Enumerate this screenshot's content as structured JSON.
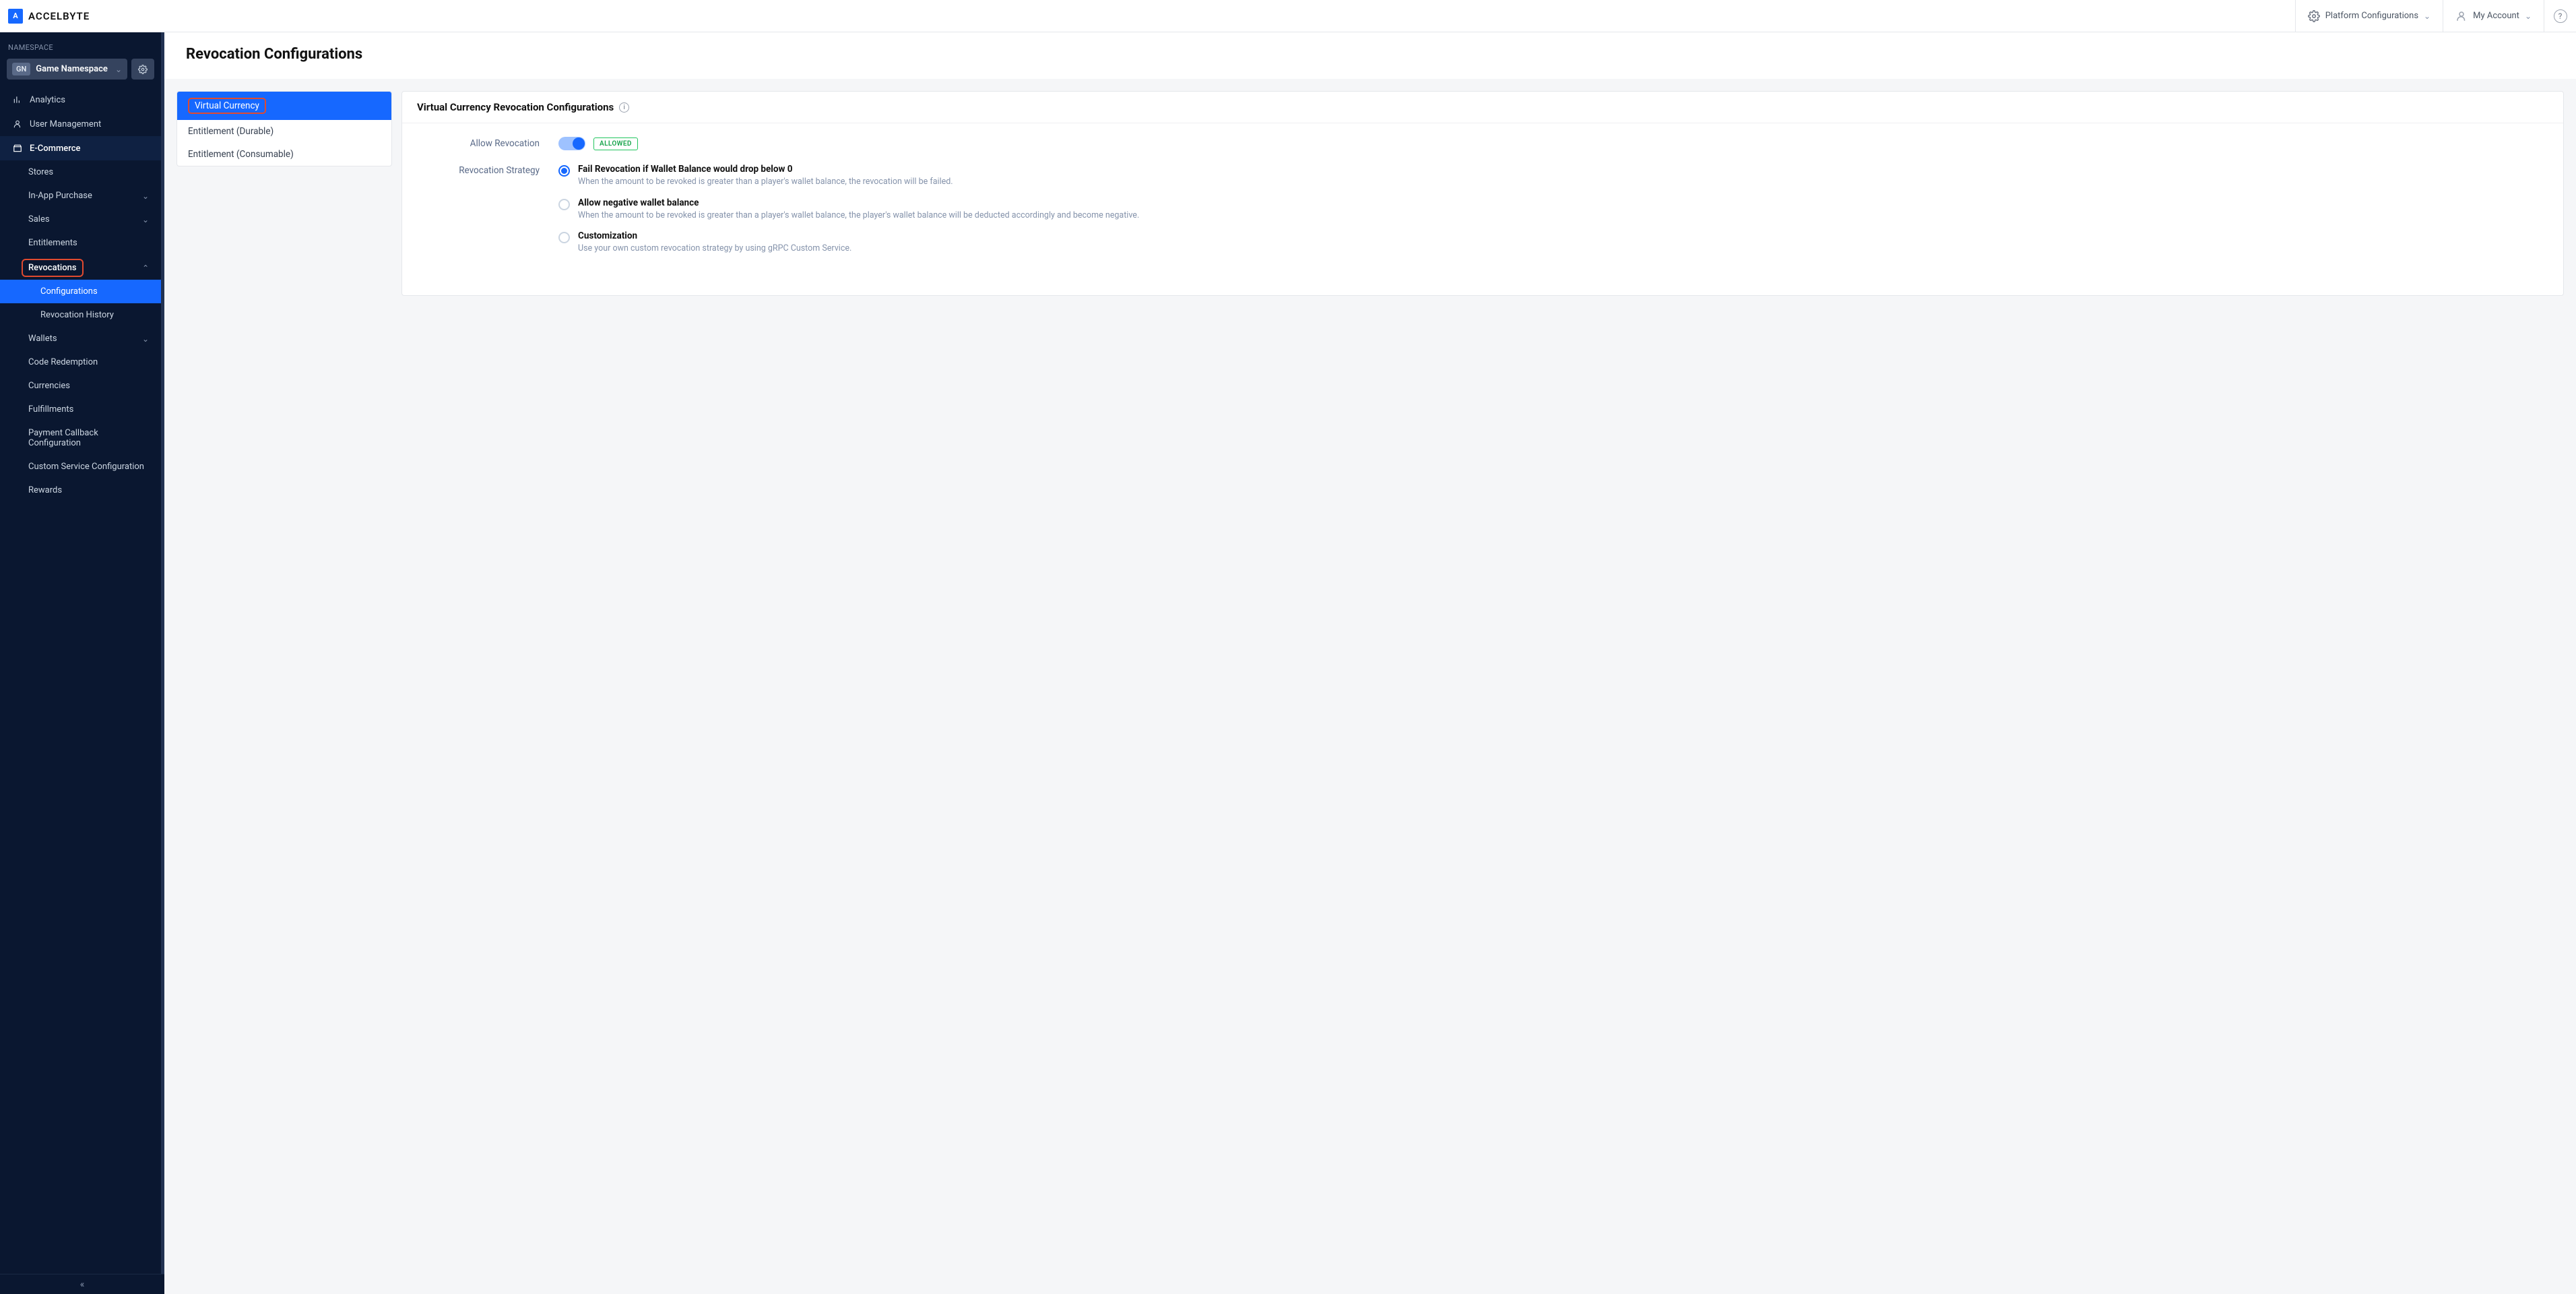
{
  "brand": {
    "logo_letters": "A",
    "name": "ACCELBYTE"
  },
  "topbar": {
    "platform_config": "Platform Configurations",
    "my_account": "My Account"
  },
  "sidebar": {
    "namespace_label": "NAMESPACE",
    "ns_badge": "GN",
    "ns_name": "Game Namespace",
    "items": {
      "analytics": "Analytics",
      "user_mgmt": "User Management",
      "ecommerce": "E-Commerce"
    },
    "ecom": {
      "stores": "Stores",
      "iap": "In-App Purchase",
      "sales": "Sales",
      "entitlements": "Entitlements",
      "revocations": "Revocations",
      "rev_sub": {
        "configurations": "Configurations",
        "history": "Revocation History"
      },
      "wallets": "Wallets",
      "code_redemption": "Code Redemption",
      "currencies": "Currencies",
      "fulfillments": "Fulfillments",
      "payment_cb": "Payment Callback Configuration",
      "custom_service": "Custom Service Configuration",
      "rewards": "Rewards"
    }
  },
  "page": {
    "title": "Revocation Configurations"
  },
  "tabs": {
    "virtual_currency": "Virtual Currency",
    "entitlement_durable": "Entitlement (Durable)",
    "entitlement_consumable": "Entitlement (Consumable)"
  },
  "card": {
    "title": "Virtual Currency Revocation Configurations",
    "allow_label": "Allow Revocation",
    "allowed_badge": "ALLOWED",
    "strategy_label": "Revocation Strategy",
    "opt1": {
      "title": "Fail Revocation if Wallet Balance would drop below 0",
      "desc": "When the amount to be revoked is greater than a player's wallet balance, the revocation will be failed."
    },
    "opt2": {
      "title": "Allow negative wallet balance",
      "desc": "When the amount to be revoked is greater than a player's wallet balance, the player's wallet balance will be deducted accordingly and become negative."
    },
    "opt3": {
      "title": "Customization",
      "desc": "Use your own custom revocation strategy by using gRPC Custom Service."
    }
  }
}
